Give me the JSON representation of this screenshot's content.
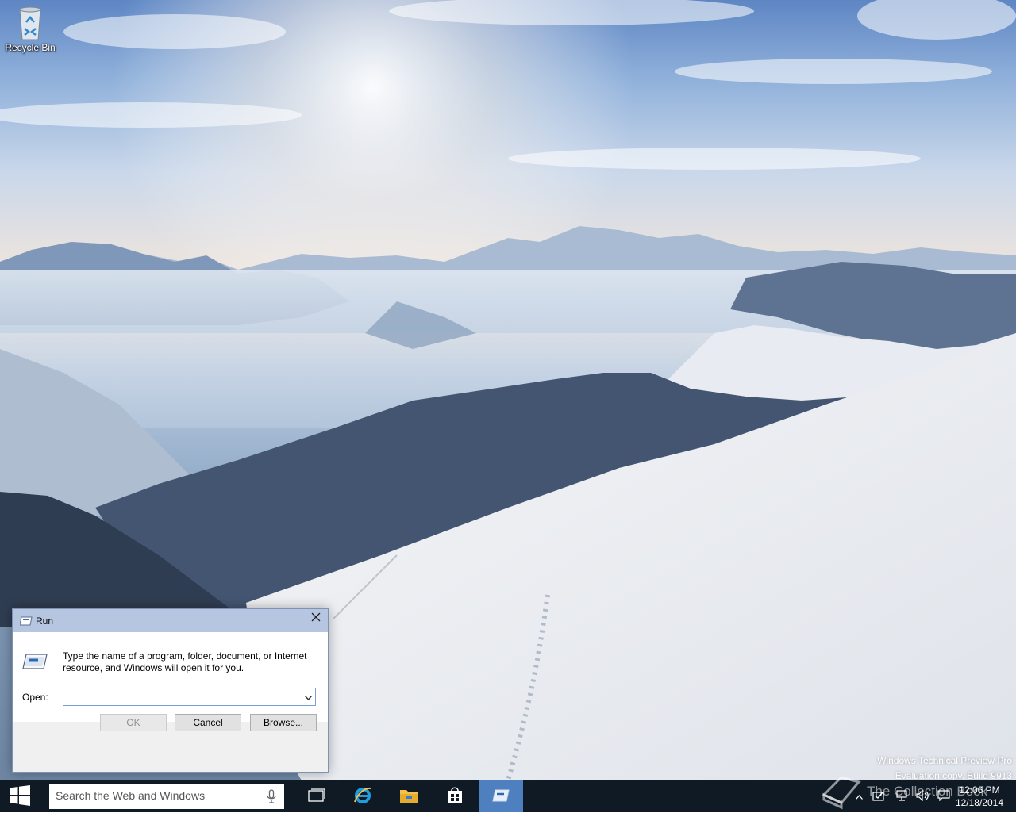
{
  "desktop": {
    "recycle_bin_label": "Recycle Bin",
    "watermark": {
      "line1": "Windows Technical Preview Pro",
      "line2": "Evaluation copy. Build 9913"
    }
  },
  "run_dialog": {
    "title": "Run",
    "description": "Type the name of a program, folder, document, or Internet resource, and Windows will open it for you.",
    "open_label": "Open:",
    "open_value": "",
    "buttons": {
      "ok": "OK",
      "cancel": "Cancel",
      "browse": "Browse..."
    },
    "icons": {
      "title": "run-icon",
      "program": "run-program-icon",
      "close": "close-icon",
      "dropdown": "chevron-down-icon"
    }
  },
  "taskbar": {
    "search_placeholder": "Search the Web and Windows",
    "pinned": [
      "task-view-icon",
      "internet-explorer-icon",
      "file-explorer-icon",
      "store-icon",
      "run-icon"
    ],
    "active_item": "run-icon",
    "clock": {
      "time": "12:06 PM",
      "date": "12/18/2014"
    },
    "overlay_text": "The Collection Book",
    "colors": {
      "taskbar": "#0f1a25",
      "active": "#4e7fbf",
      "ie": "#1e9de0",
      "explorer": "#f2c14c"
    }
  }
}
